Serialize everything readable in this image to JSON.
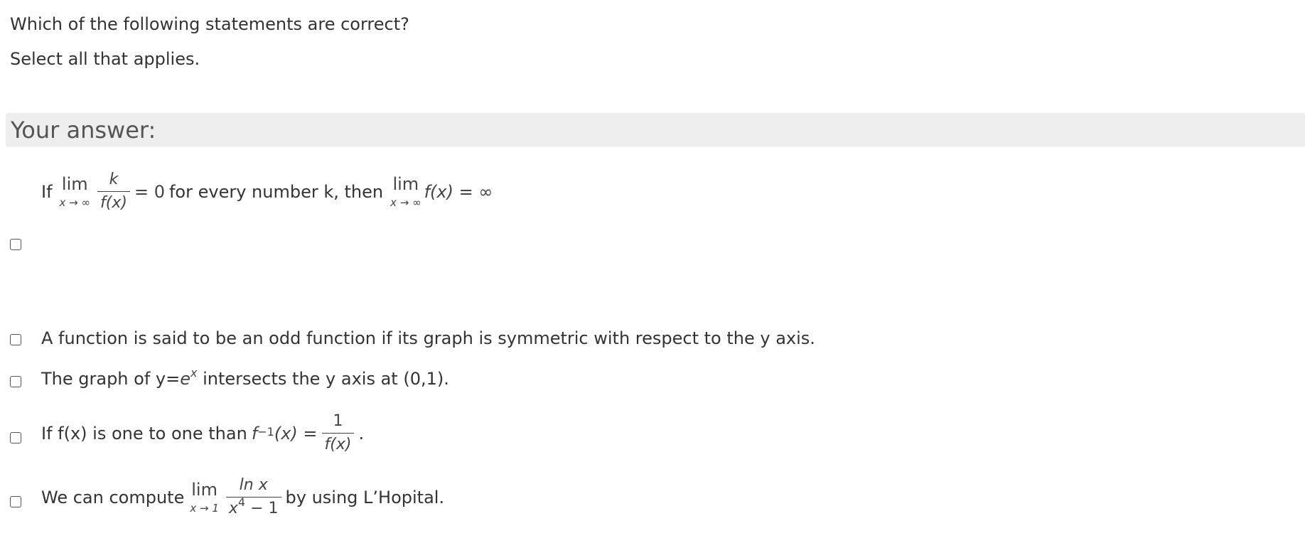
{
  "question": {
    "line1": "Which of the following statements are correct?",
    "line2": "Select all that applies."
  },
  "answer_header": "Your answer:",
  "options": [
    {
      "checked": false,
      "text_if": "If",
      "lim": "lim",
      "lim_sub": "x → ∞",
      "frac_num": "k",
      "frac_den": "f(x)",
      "eq_zero": "= 0",
      "text_mid": "for every number k, then",
      "lim2": "lim",
      "lim2_sub": "x → ∞",
      "rhs": "f(x) = ∞"
    },
    {
      "checked": false,
      "text": "A function is said to be an odd function if its graph is symmetric with respect to the y axis."
    },
    {
      "checked": false,
      "text_pre": "The graph of y=",
      "base": "e",
      "exp": "x",
      "text_post": "intersects the y axis at (0,1)."
    },
    {
      "checked": false,
      "text_pre": "If f(x) is one to one than",
      "lhs_f": "f",
      "lhs_exp": "−1",
      "lhs_arg": "(x) =",
      "frac_num": "1",
      "frac_den": "f(x)",
      "end": "."
    },
    {
      "checked": false,
      "text_pre": "We can compute",
      "lim": "lim",
      "lim_sub": "x → 1",
      "frac_num": "ln x",
      "den_base": "x",
      "den_exp": "4",
      "den_rest": " − 1",
      "text_post": "by using L’Hopital."
    }
  ]
}
